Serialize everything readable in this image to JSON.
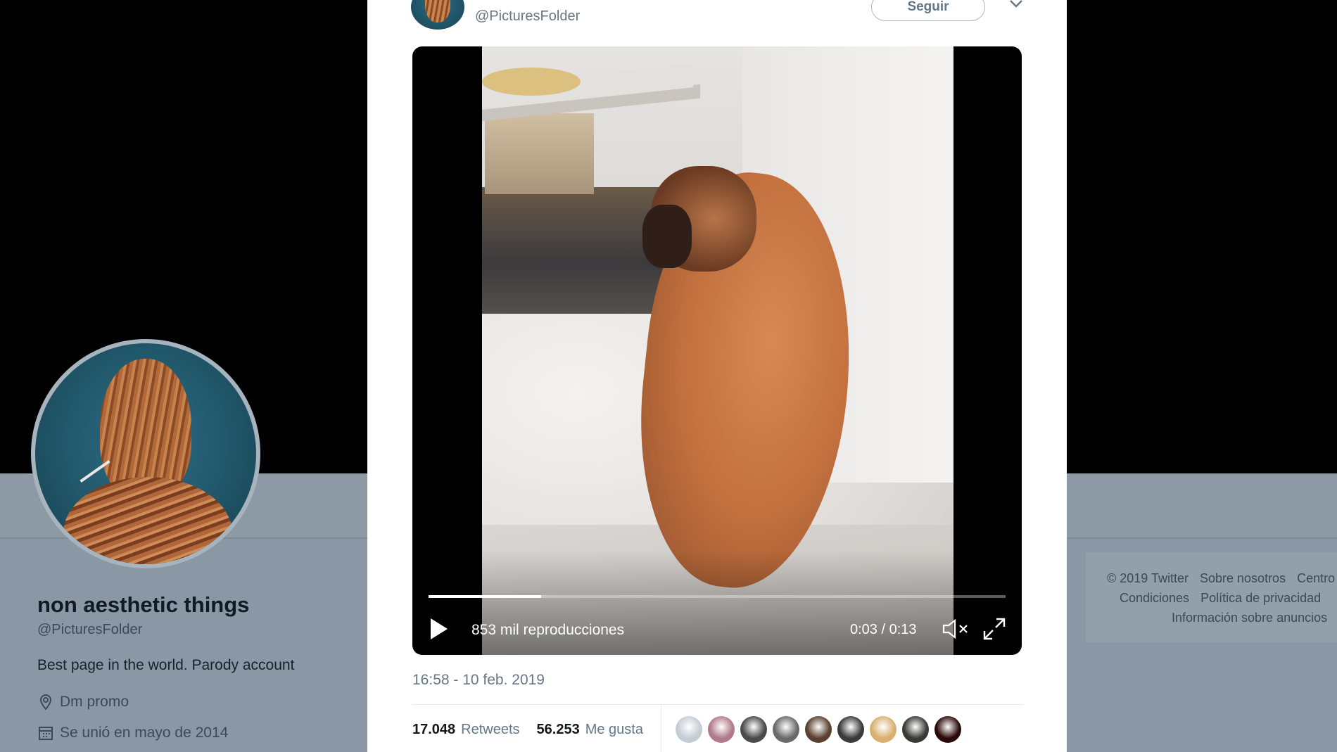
{
  "profile": {
    "name": "non aesthetic things",
    "handle": "@PicturesFolder",
    "bio": "Best page in the world. Parody account",
    "location": "Dm promo",
    "joined": "Se unió en mayo de 2014"
  },
  "tweet": {
    "handle": "@PicturesFolder",
    "follow_label": "Seguir",
    "timestamp": "16:58 - 10 feb. 2019",
    "retweets_count": "17.048",
    "retweets_label": "Retweets",
    "likes_count": "56.253",
    "likes_label": "Me gusta",
    "likers": [
      "#c5cdd4",
      "#b07a8a",
      "#4a4a4a",
      "#6a6a6a",
      "#5a4030",
      "#3a3a3a",
      "#d9b070",
      "#3a3a35",
      "#2a0a08"
    ]
  },
  "video": {
    "views": "853 mil reproducciones",
    "time": "0:03 / 0:13",
    "progress": 0.195
  },
  "footer": {
    "row1": [
      "© 2019 Twitter",
      "Sobre nosotros",
      "Centro"
    ],
    "row2": [
      "Condiciones",
      "Política de privacidad"
    ],
    "row3": [
      "Información sobre anuncios"
    ]
  },
  "icons": {
    "location": "location-pin-icon",
    "calendar": "calendar-icon",
    "play": "play-icon",
    "mute": "speaker-muted-icon",
    "fullscreen": "fullscreen-icon",
    "caret": "chevron-down-icon"
  }
}
